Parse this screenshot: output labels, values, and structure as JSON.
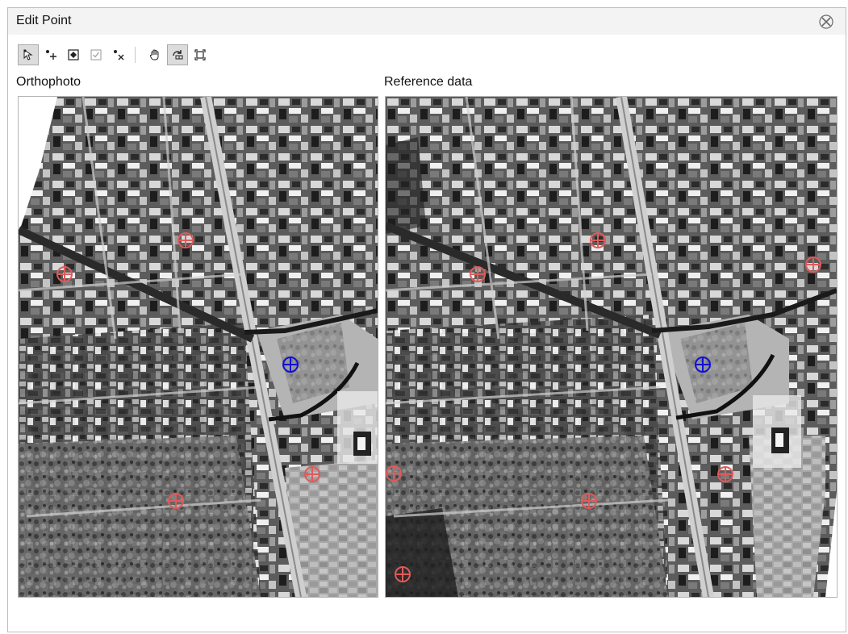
{
  "dialog": {
    "title": "Edit Point"
  },
  "toolbar": {
    "tools": [
      {
        "name": "select-tool",
        "icon": "pointer-select-icon",
        "active": true
      },
      {
        "name": "add-point-tool",
        "icon": "add-point-icon",
        "active": false
      },
      {
        "name": "edit-point-tool",
        "icon": "point-box-icon",
        "active": false
      },
      {
        "name": "accept-tool",
        "icon": "check-box-icon",
        "active": false,
        "disabled": true
      },
      {
        "name": "delete-point-tool",
        "icon": "delete-point-icon",
        "active": false
      },
      {
        "name": "pan-tool",
        "icon": "hand-pan-icon",
        "active": false
      },
      {
        "name": "link-views-tool",
        "icon": "link-views-icon",
        "active": true
      },
      {
        "name": "full-extent-tool",
        "icon": "full-extent-icon",
        "active": false
      }
    ]
  },
  "panels": {
    "left_label": "Orthophoto",
    "right_label": "Reference data"
  },
  "colors": {
    "inactive_point": "#e05a5a",
    "selected_point": "#1010d0",
    "title_bar": "#f3f3f3"
  },
  "points": {
    "orthophoto": [
      {
        "id": "p1",
        "selected": false
      },
      {
        "id": "p2",
        "selected": false
      },
      {
        "id": "p3",
        "selected": true
      },
      {
        "id": "p4",
        "selected": false
      },
      {
        "id": "p5",
        "selected": false
      }
    ],
    "reference": [
      {
        "id": "p1",
        "selected": false
      },
      {
        "id": "p2",
        "selected": false
      },
      {
        "id": "p6",
        "selected": false
      },
      {
        "id": "p3",
        "selected": true
      },
      {
        "id": "p4",
        "selected": false
      },
      {
        "id": "p5",
        "selected": false
      },
      {
        "id": "p7",
        "selected": false
      },
      {
        "id": "p8",
        "selected": false
      }
    ]
  }
}
